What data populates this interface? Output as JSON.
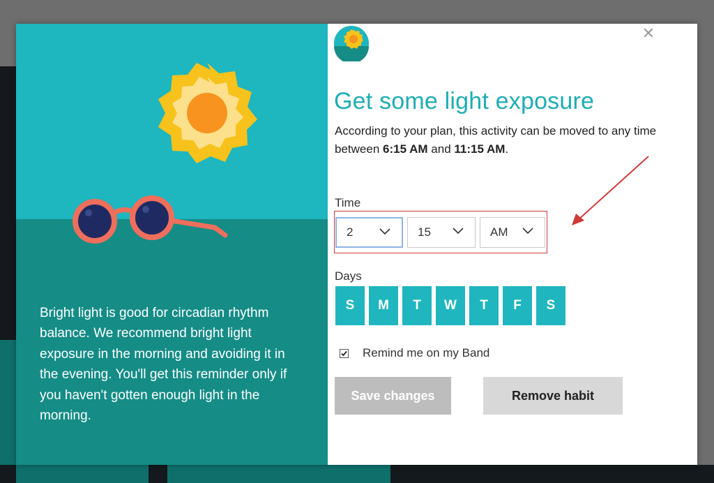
{
  "dialog": {
    "title": "Get some light exposure",
    "description_prefix": "According to your plan, this activity can be moved to any time between ",
    "start_time": "6:15 AM",
    "description_mid": " and ",
    "end_time": "11:15 AM",
    "description_suffix": ".",
    "close_icon": "close-icon",
    "avatar_icon": "sun-avatar-icon"
  },
  "info_panel": {
    "text": "Bright light is good for circadian rhythm balance. We recommend bright light exposure in the morning and avoiding it in the evening. You'll get this reminder only if you haven't gotten enough light in the morning.",
    "illustration": "sun-and-sunglasses-illustration"
  },
  "time": {
    "label": "Time",
    "hour": "2",
    "minute": "15",
    "ampm": "AM"
  },
  "days": {
    "label": "Days",
    "items": [
      "S",
      "M",
      "T",
      "W",
      "T",
      "F",
      "S"
    ]
  },
  "remind": {
    "label": "Remind me on my Band",
    "checked": true
  },
  "buttons": {
    "save": "Save changes",
    "remove": "Remove habit"
  },
  "colors": {
    "accent": "#1eb6bf",
    "floor": "#158c86",
    "annotation": "#d23a3a"
  }
}
